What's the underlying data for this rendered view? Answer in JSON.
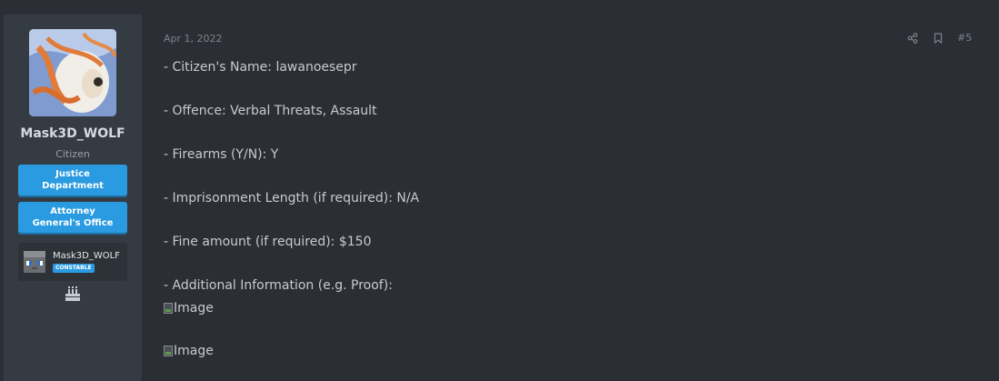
{
  "sidebar": {
    "username": "Mask3D_WOLF",
    "user_title": "Citizen",
    "banners": [
      {
        "line1": "Justice",
        "line2": "Department"
      },
      {
        "line1": "Attorney",
        "line2": "General's Office"
      }
    ],
    "linked_account": {
      "name": "Mask3D_WOLF",
      "badge": "CONSTABLE"
    }
  },
  "post": {
    "date": "Apr 1, 2022",
    "number": "#5",
    "lines": [
      "- Citizen's Name: lawanoesepr",
      "- Offence: Verbal Threats, Assault",
      "- Firearms (Y/N): Y",
      "- Imprisonment Length (if required): N/A",
      "- Fine amount (if required): $150",
      "- Additional Information (e.g. Proof):"
    ],
    "images": [
      {
        "alt": "Image"
      },
      {
        "alt": "Image"
      }
    ]
  },
  "colors": {
    "background": "#2b2f35",
    "sidebar": "#353b43",
    "banner": "#2a9be0",
    "text": "#c7cbd1",
    "muted": "#7c828a"
  },
  "icons": [
    "share-icon",
    "bookmark-icon",
    "birthday-cake-icon"
  ]
}
